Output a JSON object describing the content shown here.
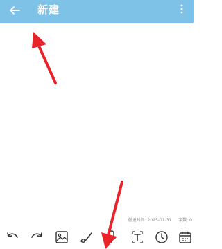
{
  "header": {
    "title": "新建",
    "back_icon": "arrow-left-icon",
    "menu_icon": "more-vertical-icon",
    "background": "#7ec3e7"
  },
  "footer_meta": {
    "created_label": "创建时间:",
    "created_value": "2025-01-31",
    "wordcount_label": "字数:",
    "wordcount_value": "0"
  },
  "toolbar": {
    "tools": [
      "undo-icon",
      "redo-icon",
      "image-icon",
      "brush-icon",
      "microphone-icon",
      "text-format-icon",
      "clock-icon",
      "calendar-icon"
    ]
  },
  "annotations": {
    "arrow_color": "#e8232a"
  }
}
